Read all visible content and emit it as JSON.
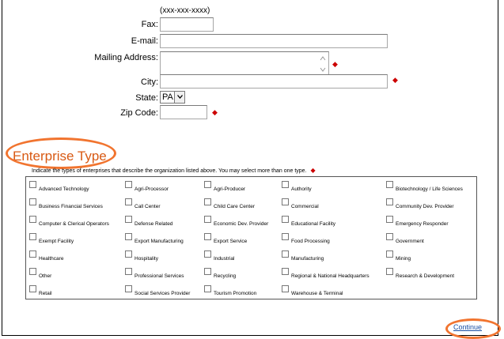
{
  "form": {
    "phone_format_hint": "(xxx-xxx-xxxx)",
    "fax_label": "Fax:",
    "email_label": "E-mail:",
    "mailing_label": "Mailing Address:",
    "city_label": "City:",
    "state_label": "State:",
    "state_value": "PA",
    "zip_label": "Zip Code:",
    "required_marker": "◆"
  },
  "enterprise": {
    "title": "Enterprise Type",
    "instruction": "Indicate the types of enterprises that describe the organization listed above.  You may select more than one type.",
    "columns": [
      [
        "Advanced Technology",
        "Business Financial Services",
        "Computer & Clerical Operators",
        "Exempt Facility",
        "Healthcare",
        "Other",
        "Retail"
      ],
      [
        "Agri-Processor",
        "Call Center",
        "Defense Related",
        "Export Manufacturing",
        "Hospitality",
        "Professional Services",
        "Social Services Provider"
      ],
      [
        "Agri-Producer",
        "Child Care Center",
        "Economic Dev. Provider",
        "Export Service",
        "Industrial",
        "Recycling",
        "Tourism Promotion"
      ],
      [
        "Authority",
        "Commercial",
        "Educational Facility",
        "Food Processing",
        "Manufacturing",
        "Regional & National Headquarters",
        "Warehouse & Terminal"
      ],
      [
        "Biotechnology / Life Sciences",
        "Community Dev. Provider",
        "Emergency Responder",
        "Government",
        "Mining",
        "Research & Development"
      ]
    ]
  },
  "footer": {
    "continue_label": "Continue"
  },
  "colors": {
    "accent_orange": "#f1742f",
    "required_red": "#cc0000",
    "link_blue": "#1a4fa3"
  }
}
